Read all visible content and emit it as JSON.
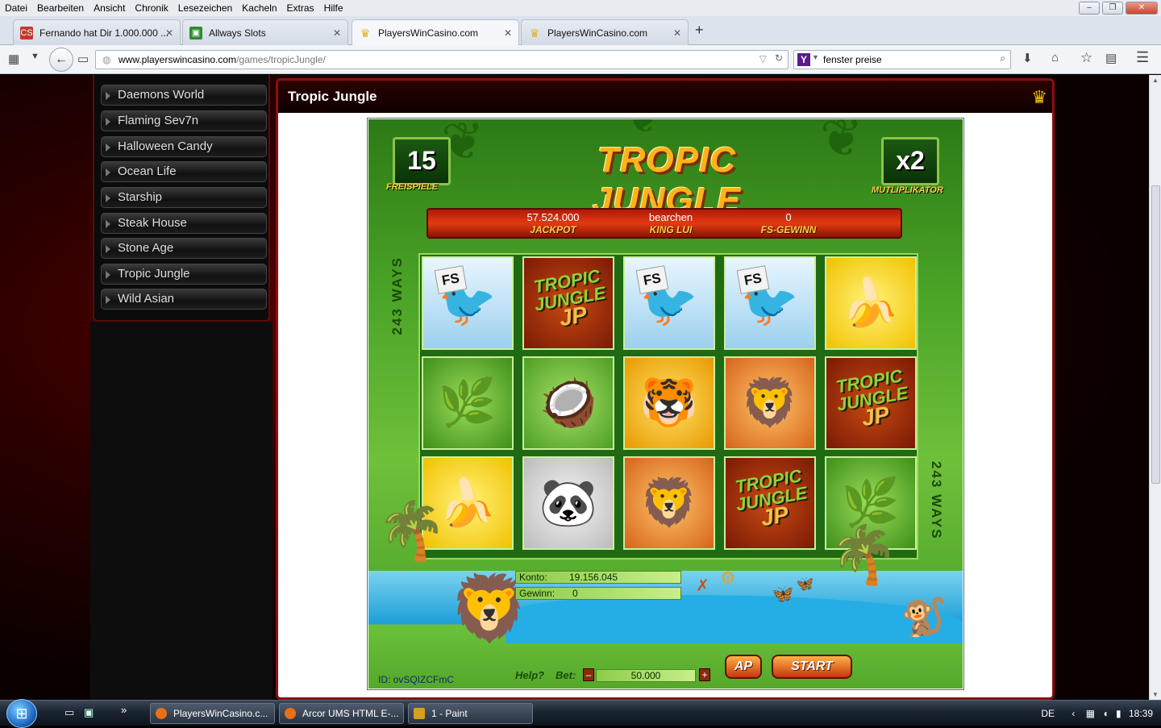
{
  "menu": [
    "Datei",
    "Bearbeiten",
    "Ansicht",
    "Chronik",
    "Lesezeichen",
    "Kacheln",
    "Extras",
    "Hilfe"
  ],
  "window_controls": {
    "minimize": "–",
    "maximize": "❐",
    "close": "✕"
  },
  "tabs": [
    {
      "label": "Fernando hat Dir 1.000.000 ...",
      "icon": "CS",
      "icon_color": "#c0392b"
    },
    {
      "label": "Allways Slots",
      "icon": "▣",
      "icon_color": "#2e8b2e"
    },
    {
      "label": "PlayersWinCasino.com",
      "icon": "♛",
      "icon_color": "#e0b020",
      "active": true
    },
    {
      "label": "PlayersWinCasino.com",
      "icon": "♛",
      "icon_color": "#e0b020"
    }
  ],
  "url": {
    "host": "www.playerswincasino.com",
    "path": "/games/tropicJungle/"
  },
  "search": {
    "engine": "Y",
    "value": "fenster preise"
  },
  "sidebar": {
    "items": [
      "Daemons World",
      "Flaming Sev7n",
      "Halloween Candy",
      "Ocean Life",
      "Starship",
      "Steak House",
      "Stone Age",
      "Tropic Jungle",
      "Wild Asian"
    ]
  },
  "game_panel": {
    "title": "Tropic Jungle",
    "crown": "♛"
  },
  "game": {
    "logo": "TROPIC JUNGLE",
    "freespins": {
      "value": "15",
      "label": "FREISPIELE"
    },
    "multiplier": {
      "value": "x2",
      "label": "MUTLIPLIKATOR"
    },
    "jackpot": {
      "value": "57.524.000",
      "label": "JACKPOT"
    },
    "king": {
      "value": "bearchen",
      "label": "KING LUI"
    },
    "fs_win": {
      "value": "0",
      "label": "FS-GEWINN"
    },
    "ways_label": "243 WAYS",
    "reels": [
      [
        "toucan-fs",
        "jp",
        "toucan-fs",
        "toucan-fs",
        "banana"
      ],
      [
        "plant",
        "coconut",
        "tiger",
        "lion",
        "jp"
      ],
      [
        "banana",
        "panda",
        "lion",
        "jp",
        "plant"
      ]
    ],
    "fs_tag": "FS",
    "jp_lines": [
      "TROPIC",
      "JUNGLE",
      "JP"
    ],
    "konto": {
      "label": "Konto:",
      "value": "19.156.045"
    },
    "gewinn": {
      "label": "Gewinn:",
      "value": "0"
    },
    "game_id": "ID: ovSQIZCFmC",
    "help": "Help?",
    "bet_label": "Bet:",
    "bet_value": "50.000",
    "minus": "–",
    "plus": "+",
    "ap": "AP",
    "start": "START"
  },
  "taskbar": {
    "start": "⊞",
    "buttons": [
      {
        "label": "PlayersWinCasino.c...",
        "color": "#e8701a"
      },
      {
        "label": "Arcor UMS HTML E-...",
        "color": "#e8701a"
      },
      {
        "label": "1 - Paint",
        "color": "#d4a020"
      }
    ],
    "lang": "DE",
    "time": "18:39"
  }
}
